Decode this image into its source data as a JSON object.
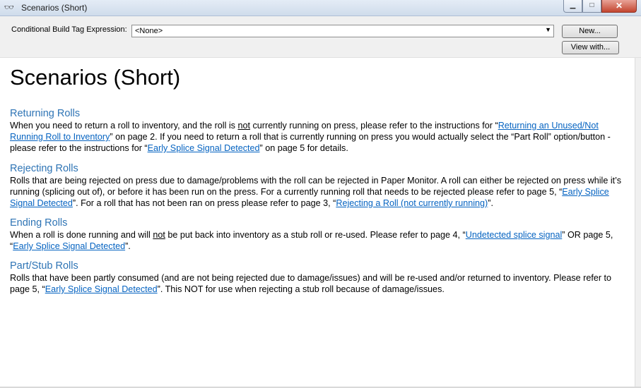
{
  "window": {
    "title": "Scenarios (Short)",
    "icon": "glasses-icon",
    "minimize_glyph": "▁",
    "maximize_glyph": "□",
    "close_glyph": "✕"
  },
  "toolbar": {
    "cbt_label": "Conditional Build Tag Expression:",
    "cbt_value": "<None>",
    "new_label": "New...",
    "view_label": "View with..."
  },
  "content": {
    "page_title": "Scenarios (Short)",
    "sections": [
      {
        "heading": "Returning Rolls",
        "t1": "When you need to return a roll to inventory, and the roll is ",
        "t2": "not",
        "t3": " currently running on press, please refer to the instructions for “",
        "l1": "Returning an Unused/Not Running Roll to Inventory",
        "t4": "” on page 2.  If you need to return a roll that is currently running on press you would actually select the “Part Roll” option/button - please refer to the instructions for “",
        "l2": "Early Splice Signal Detected",
        "t5": "” on page 5 for details."
      },
      {
        "heading": "Rejecting Rolls",
        "t1": "Rolls that are being rejected on press due to damage/problems with the roll can be rejected in Paper Monitor.  A roll can either be rejected on press while it’s running (splicing out of), or before it has been run on the press.  For a currently running roll that needs to be rejected please refer to page 5, “",
        "l1": "Early Splice Signal Detected",
        "t2": "”.  For a roll that has not been ran on press please refer to page 3, “",
        "l2": "Rejecting a Roll (not currently running)",
        "t3": "”."
      },
      {
        "heading": "Ending Rolls",
        "t1": "When a roll is done running and will ",
        "t2": "not",
        "t3": " be put back into inventory as a stub roll or re-used.  Please refer to page 4, “",
        "l1": "Undetected splice signal",
        "t4": "” OR page 5, “",
        "l2": "Early Splice Signal Detected",
        "t5": "”."
      },
      {
        "heading": "Part/Stub Rolls",
        "t1": "Rolls that have been partly consumed (and are not being rejected due to damage/issues) and will be re-used and/or returned to inventory.  Please refer to page 5, “",
        "l1": "Early Splice Signal Detected",
        "t2": "”.  This NOT for use when rejecting a stub roll because of damage/issues."
      }
    ]
  },
  "colors": {
    "heading": "#2e74b5",
    "link": "#0563c1"
  }
}
